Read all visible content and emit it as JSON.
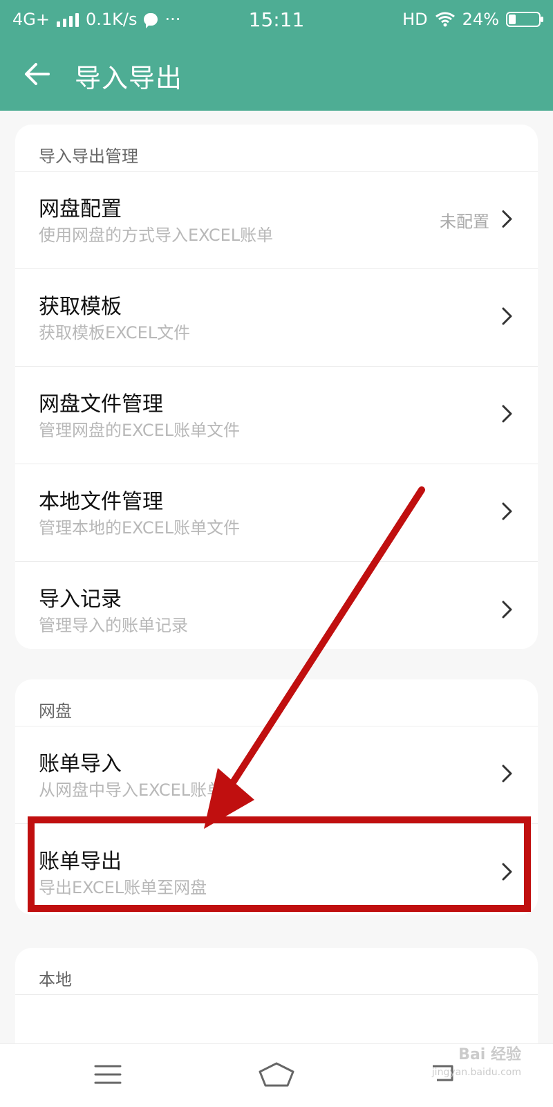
{
  "status_bar": {
    "network": "4G+",
    "speed": "0.1K/s",
    "more": "···",
    "time": "15:11",
    "hd": "HD",
    "battery": "24%",
    "battery_level": 0.24
  },
  "app_bar": {
    "title": "导入导出"
  },
  "sections": {
    "manage": {
      "header": "导入导出管理",
      "items": [
        {
          "title": "网盘配置",
          "subtitle": "使用网盘的方式导入EXCEL账单",
          "status": "未配置"
        },
        {
          "title": "获取模板",
          "subtitle": "获取模板EXCEL文件"
        },
        {
          "title": "网盘文件管理",
          "subtitle": "管理网盘的EXCEL账单文件"
        },
        {
          "title": "本地文件管理",
          "subtitle": "管理本地的EXCEL账单文件"
        },
        {
          "title": "导入记录",
          "subtitle": "管理导入的账单记录"
        }
      ]
    },
    "cloud": {
      "header": "网盘",
      "items": [
        {
          "title": "账单导入",
          "subtitle": "从网盘中导入EXCEL账单"
        },
        {
          "title": "账单导出",
          "subtitle": "导出EXCEL账单至网盘"
        }
      ]
    },
    "local": {
      "header": "本地"
    }
  },
  "colors": {
    "primary": "#4ead94",
    "annotation": "#c00f0f"
  },
  "icons": {
    "back": "arrow-left",
    "chevron": "chevron-right",
    "menu": "hamburger-menu",
    "home": "home-outline",
    "back_nav": "back-outline"
  },
  "watermark": {
    "main": "Bai 经验",
    "small": "jingyan.baidu.com"
  }
}
